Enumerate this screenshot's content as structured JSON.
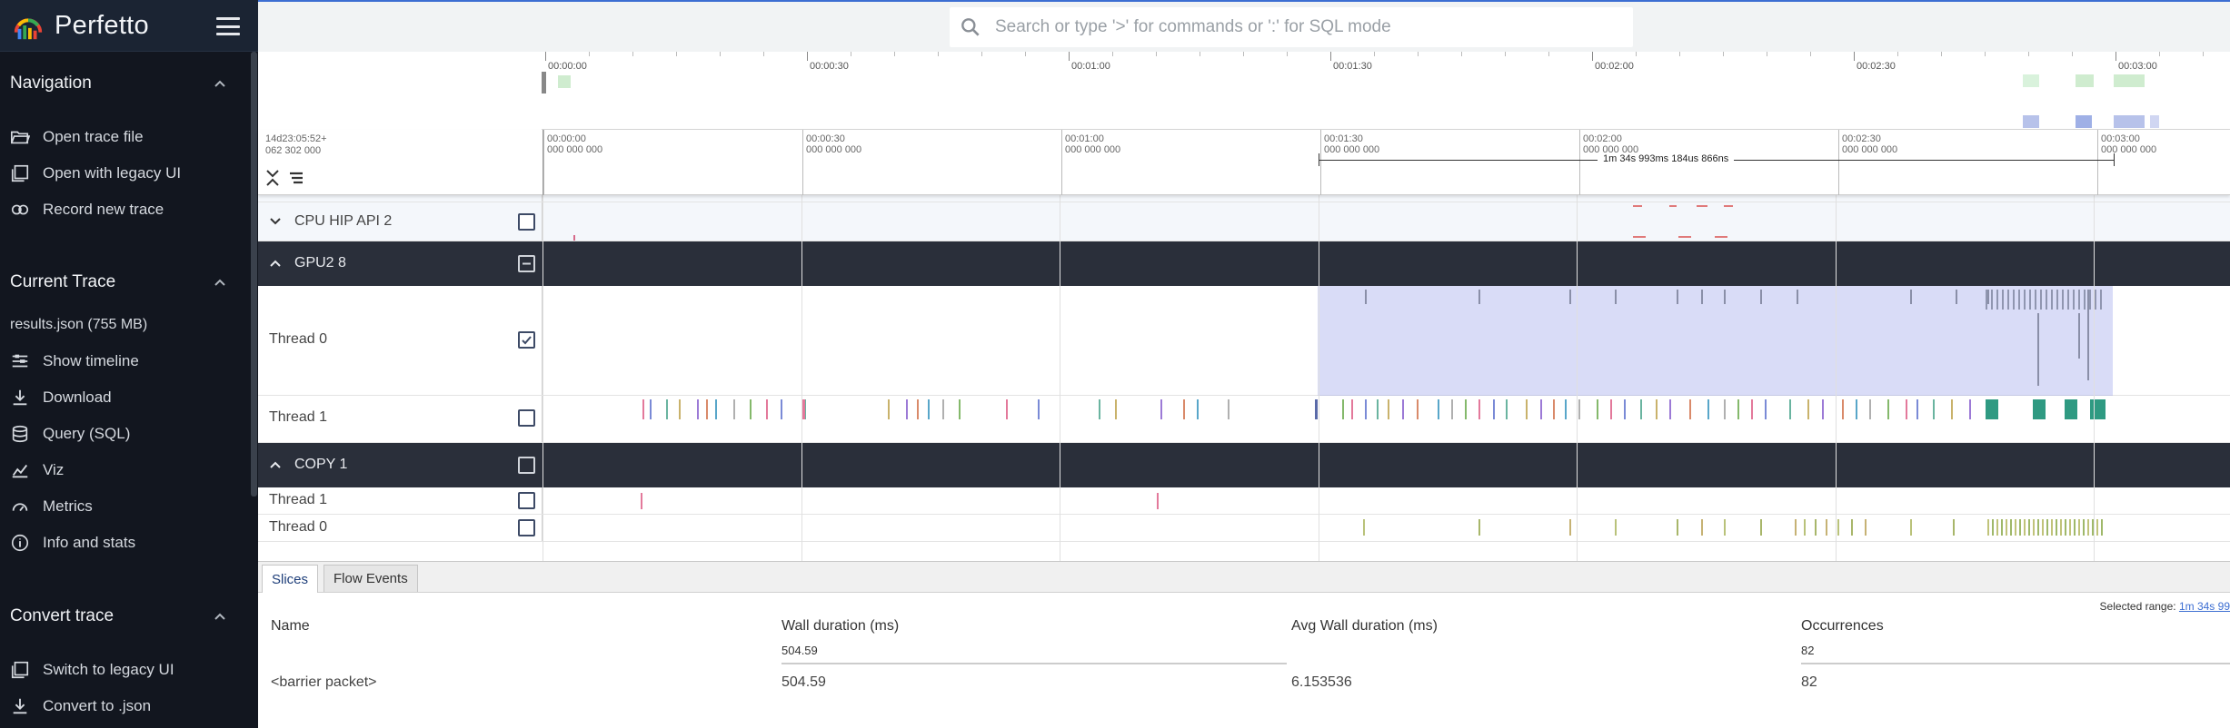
{
  "app": {
    "brand": "Perfetto",
    "accent_color": "#3c6ed2"
  },
  "sidebar": {
    "sections": [
      {
        "title": "Navigation",
        "items": [
          {
            "label": "Open trace file",
            "icon": "folder-open-icon"
          },
          {
            "label": "Open with legacy UI",
            "icon": "filter-none-icon"
          },
          {
            "label": "Record new trace",
            "icon": "record-icon"
          }
        ]
      },
      {
        "title": "Current Trace",
        "trace_file": "results.json (755 MB)",
        "items": [
          {
            "label": "Show timeline",
            "icon": "timeline-icon"
          },
          {
            "label": "Download",
            "icon": "download-icon"
          },
          {
            "label": "Query (SQL)",
            "icon": "database-icon"
          },
          {
            "label": "Viz",
            "icon": "chart-icon"
          },
          {
            "label": "Metrics",
            "icon": "speedometer-icon"
          },
          {
            "label": "Info and stats",
            "icon": "info-icon"
          }
        ]
      },
      {
        "title": "Convert trace",
        "items": [
          {
            "label": "Switch to legacy UI",
            "icon": "filter-none-icon"
          },
          {
            "label": "Convert to .json",
            "icon": "download-icon"
          }
        ]
      }
    ]
  },
  "search": {
    "placeholder": "Search or type '>' for commands or ':' for SQL mode"
  },
  "overview": {
    "tick_labels": [
      "00:00:00",
      "00:00:30",
      "00:01:00",
      "00:01:30",
      "00:02:00",
      "00:02:30",
      "00:03:00"
    ]
  },
  "time_axis": {
    "offset_line1": "14d23:05:52+",
    "offset_line2": "062 302 000",
    "ticks": [
      {
        "top": "00:00:00",
        "bottom": "000 000 000"
      },
      {
        "top": "00:00:30",
        "bottom": "000 000 000"
      },
      {
        "top": "00:01:00",
        "bottom": "000 000 000"
      },
      {
        "top": "00:01:30",
        "bottom": "000 000 000"
      },
      {
        "top": "00:02:00",
        "bottom": "000 000 000"
      },
      {
        "top": "00:02:30",
        "bottom": "000 000 000"
      },
      {
        "top": "00:03:00",
        "bottom": "000 000 000"
      }
    ],
    "selection_span_label": "1m 34s 993ms 184us 866ns"
  },
  "tracks": {
    "cpu_hip_api": "CPU HIP API 2",
    "gpu_group": "GPU2 8",
    "gpu_thread0": "Thread 0",
    "gpu_thread1": "Thread 1",
    "copy_group": "COPY 1",
    "copy_thread1": "Thread 1",
    "copy_thread0": "Thread 0"
  },
  "details": {
    "tabs": [
      "Slices",
      "Flow Events"
    ],
    "active_tab": "Slices",
    "selected_range_label": "Selected range:",
    "selected_range_value": "1m 34s 99",
    "columns": {
      "name": "Name",
      "wall": "Wall duration (ms)",
      "avg": "Avg Wall duration (ms)",
      "occ": "Occurrences"
    },
    "summary": {
      "wall": "504.59",
      "occ": "82"
    },
    "rows": [
      {
        "name": "<barrier packet>",
        "wall": "504.59",
        "avg": "6.153536",
        "occ": "82"
      }
    ]
  }
}
